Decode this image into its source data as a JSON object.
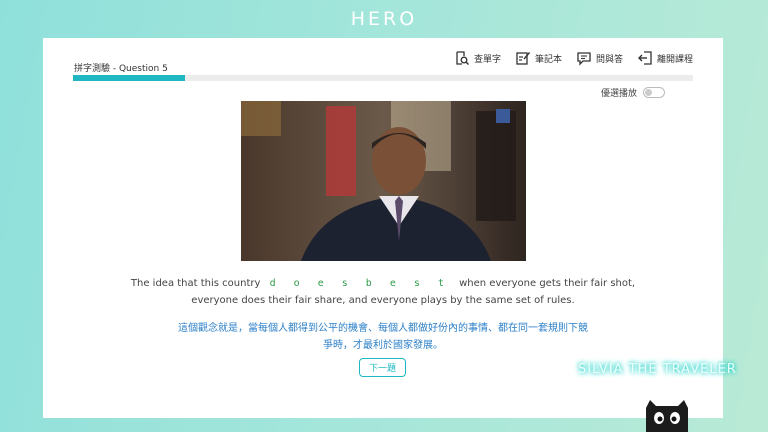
{
  "brand": "HERO",
  "quiz": {
    "title": "拼字測驗 - Question 5",
    "progress_fraction": 0.18
  },
  "toolbar": {
    "lookup": "查單字",
    "notes": "筆記本",
    "qa": "問與答",
    "exit": "離開課程"
  },
  "autoplay": {
    "label": "優選播放",
    "on": false
  },
  "exercise": {
    "before": "The idea that this country",
    "blank": "d o e s   b e s t",
    "after": "when everyone gets their fair shot,",
    "line2": "everyone does their fair share, and everyone plays by the same set of rules."
  },
  "translation": {
    "line1": "這個觀念就是，當每個人都得到公平的機會、每個人都做好份內的事情、都在同一套規則下競",
    "line2": "爭時，才最利於國家發展。"
  },
  "next_button": "下一題",
  "watermark": "SILVIA THE TRAVELER",
  "colors": {
    "accent": "#1fb8c2",
    "translation": "#2b7fc8",
    "blank": "#2f9b4b"
  }
}
